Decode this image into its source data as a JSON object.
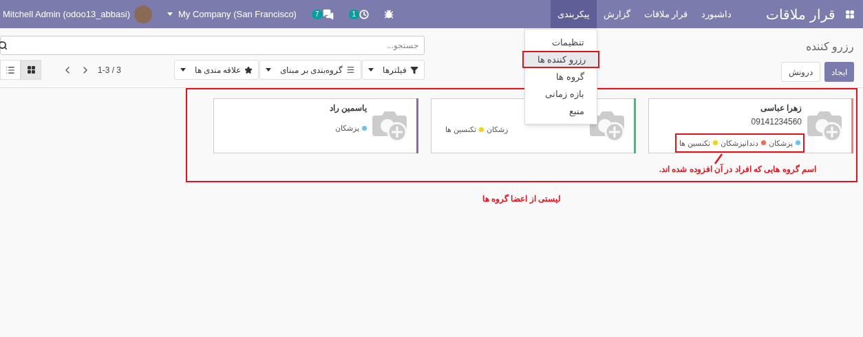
{
  "navbar": {
    "app_title": "قرار ملاقات",
    "menu": [
      {
        "label": "داشبورد",
        "selected": false
      },
      {
        "label": "قرار ملاقات",
        "selected": false
      },
      {
        "label": "گزارش",
        "selected": false
      },
      {
        "label": "پیکربندی",
        "selected": true
      }
    ],
    "messages_count": "7",
    "activities_count": "1",
    "company": "My Company (San Francisco)",
    "user": "Mitchell Admin (odoo13_abbasi)"
  },
  "dropdown": {
    "items": [
      {
        "label": "تنظیمات",
        "selected": false
      },
      {
        "label": "رزرو کننده ها",
        "selected": true
      },
      {
        "label": "گروه ها",
        "selected": false
      },
      {
        "label": "بازه زمانی",
        "selected": false
      },
      {
        "label": "منبع",
        "selected": false
      }
    ]
  },
  "breadcrumb": "رزرو کننده",
  "buttons": {
    "create": "ایجاد",
    "import": "درونش"
  },
  "search": {
    "placeholder": "جستجو..."
  },
  "filters": [
    {
      "kind": "filter",
      "label": "فیلترها"
    },
    {
      "kind": "group",
      "label": "گروه‌بندی بر مبنای"
    },
    {
      "kind": "favorite",
      "label": "علاقه مندی ها"
    }
  ],
  "pager": "1-3 / 3",
  "views": [
    {
      "kind": "kanban",
      "selected": true
    },
    {
      "kind": "list",
      "selected": false
    }
  ],
  "cards": [
    {
      "name": "زهرا عباسی",
      "phone": "09141234560",
      "color": "#f08080",
      "highlighted": true,
      "tags": [
        {
          "label": "پزشکان",
          "color": "#6cc1ed"
        },
        {
          "label": "دندانپزشکان",
          "color": "#ed6a5a"
        },
        {
          "label": "تکنسین ها",
          "color": "#f7cd1f"
        }
      ]
    },
    {
      "color": "#30c381",
      "highlighted": false,
      "tags": [
        {
          "label": "زشکان"
        },
        {
          "label": "تکنسین ها",
          "color": "#f7cd1f"
        }
      ]
    },
    {
      "name": "یاسمین راد",
      "color": "#9365b8",
      "highlighted": false,
      "tags": [
        {
          "label": "پزشکان",
          "color": "#6cc1ed"
        }
      ]
    }
  ],
  "annotations": {
    "tags_note": "اسم گروه هایی که افراد  در آن افزوده شده اند.",
    "list_note": "لیستی از اعضا گروه ها"
  }
}
